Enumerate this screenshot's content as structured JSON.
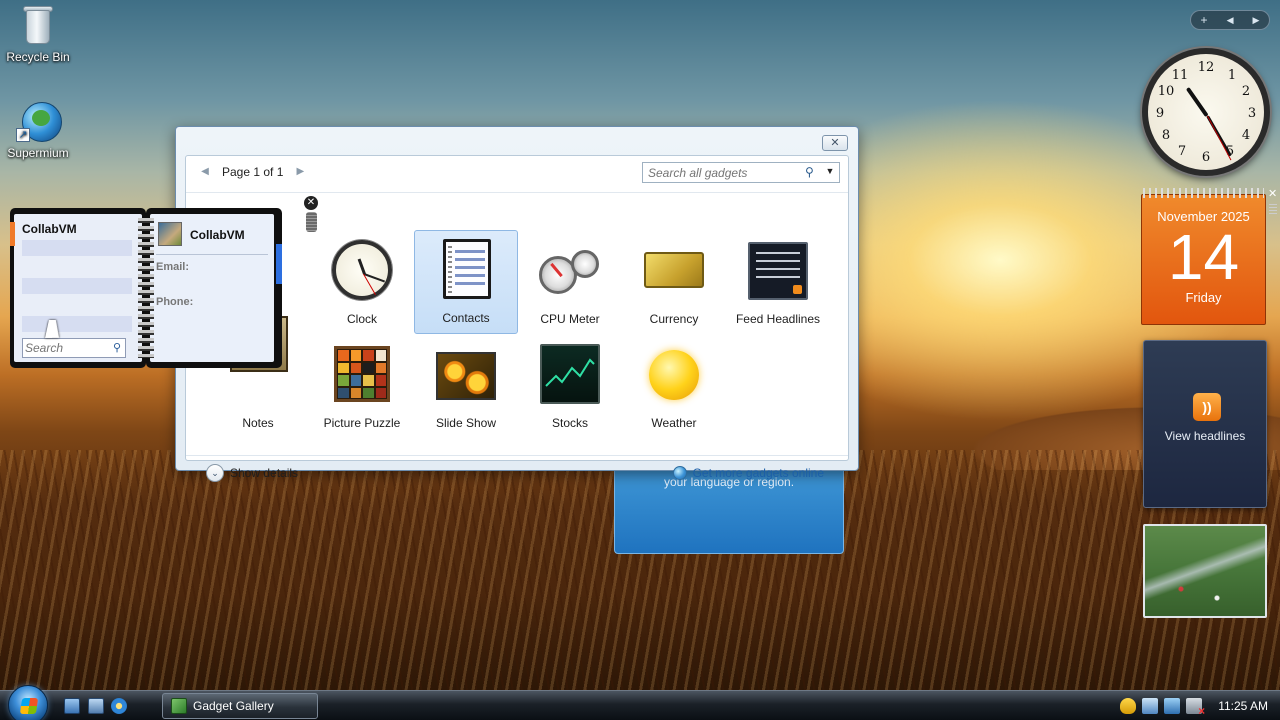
{
  "desktop": {
    "icons": [
      {
        "label": "Recycle Bin",
        "icon": "recycle-bin-icon"
      },
      {
        "label": "Supermium",
        "icon": "supermium-browser-icon"
      }
    ]
  },
  "gallery": {
    "close_glyph": "✕",
    "page_label": "Page 1 of 1",
    "prev_arrow": "◀",
    "next_arrow": "▶",
    "search_placeholder": "Search all gadgets",
    "search_icon_glyph": "⚲",
    "dropdown_glyph": "▼",
    "gadgets": [
      {
        "label": "Clock",
        "icon": "clock-gadget-icon"
      },
      {
        "label": "Contacts",
        "icon": "contacts-gadget-icon",
        "selected": true
      },
      {
        "label": "CPU Meter",
        "icon": "cpu-meter-gadget-icon"
      },
      {
        "label": "Currency",
        "icon": "currency-gadget-icon"
      },
      {
        "label": "Feed Headlines",
        "icon": "feed-headlines-gadget-icon"
      },
      {
        "label": "Notes",
        "icon": "notes-gadget-icon"
      },
      {
        "label": "Picture Puzzle",
        "icon": "picture-puzzle-gadget-icon"
      },
      {
        "label": "Slide Show",
        "icon": "slide-show-gadget-icon"
      },
      {
        "label": "Stocks",
        "icon": "stocks-gadget-icon"
      },
      {
        "label": "Weather",
        "icon": "weather-gadget-icon"
      }
    ],
    "show_details_label": "Show details",
    "show_details_glyph": "⌄",
    "get_more_label": "Get more gadgets online"
  },
  "contacts_gadget": {
    "list_name": "CollabVM",
    "search_placeholder": "Search",
    "search_icon_glyph": "⚲",
    "detail_name": "CollabVM",
    "email_label": "Email:",
    "phone_label": "Phone:",
    "close_glyph": "✕"
  },
  "blue_panel": {
    "text": "your language or region."
  },
  "sidebar": {
    "add_glyph": "+",
    "prev_glyph": "◀",
    "next_glyph": "▶",
    "clock_numbers": [
      "12",
      "1",
      "2",
      "3",
      "4",
      "5",
      "6",
      "7",
      "8",
      "9",
      "10",
      "11"
    ],
    "calendar": {
      "month": "November 2025",
      "day": "14",
      "weekday": "Friday",
      "close_glyph": "✕"
    },
    "feed": {
      "rss_glyph": "))",
      "label": "View headlines"
    }
  },
  "taskbar": {
    "task_button_label": "Gadget Gallery",
    "clock": "11:25 AM"
  },
  "colors": {
    "calendar_orange": "#e2560e",
    "link_blue": "#1c5fa8",
    "selection_blue": "#c6def7"
  }
}
